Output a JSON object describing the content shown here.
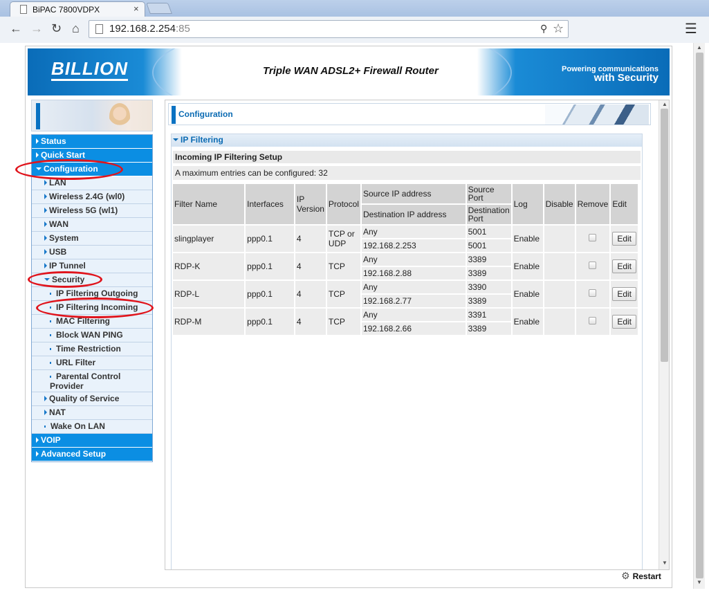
{
  "browser": {
    "tab_title": "BiPAC 7800VDPX",
    "tab_close": "×",
    "url_host": "192.168.2.254",
    "url_port": ":85",
    "icons": [
      "back-icon",
      "forward-icon",
      "reload-icon",
      "home-icon",
      "page-icon",
      "key-icon",
      "star-icon",
      "menu-icon"
    ]
  },
  "banner": {
    "brand": "BILLION",
    "product": "Triple WAN ADSL2+ Firewall Router",
    "tagline_1": "Powering communications",
    "tagline_2": "with Security"
  },
  "nav": {
    "status": "Status",
    "quick_start": "Quick Start",
    "configuration": "Configuration",
    "lan": "LAN",
    "wireless_24": "Wireless 2.4G (wl0)",
    "wireless_5": "Wireless 5G (wl1)",
    "wan": "WAN",
    "system": "System",
    "usb": "USB",
    "ip_tunnel": "IP Tunnel",
    "security": "Security",
    "ip_filter_out": "IP Filtering Outgoing",
    "ip_filter_in": "IP Filtering Incoming",
    "mac_filter": "MAC Filtering",
    "block_wan_ping": "Block WAN PING",
    "time_restriction": "Time Restriction",
    "url_filter": "URL Filter",
    "parental_control": "Parental Control Provider",
    "qos": "Quality of Service",
    "nat": "NAT",
    "wol": "Wake On LAN",
    "voip": "VOIP",
    "advanced_setup": "Advanced Setup"
  },
  "page": {
    "heading": "Configuration",
    "section": "IP Filtering",
    "subtitle": "Incoming IP Filtering Setup",
    "note": "A maximum entries can be configured: 32"
  },
  "table": {
    "headers": {
      "filter_name": "Filter Name",
      "interfaces": "Interfaces",
      "ip_version": "IP Version",
      "protocol": "Protocol",
      "src_ip": "Source IP address",
      "dst_ip": "Destination IP address",
      "src_port": "Source Port",
      "dst_port": "Destination Port",
      "log": "Log",
      "disable": "Disable",
      "remove": "Remove",
      "edit": "Edit"
    },
    "rows": [
      {
        "name": "slingplayer",
        "iface": "ppp0.1",
        "ipver": "4",
        "proto": "TCP or UDP",
        "src_ip": "Any",
        "dst_ip": "192.168.2.253",
        "src_port": "5001",
        "dst_port": "5001",
        "log": "Enable",
        "edit": "Edit"
      },
      {
        "name": "RDP-K",
        "iface": "ppp0.1",
        "ipver": "4",
        "proto": "TCP",
        "src_ip": "Any",
        "dst_ip": "192.168.2.88",
        "src_port": "3389",
        "dst_port": "3389",
        "log": "Enable",
        "edit": "Edit"
      },
      {
        "name": "RDP-L",
        "iface": "ppp0.1",
        "ipver": "4",
        "proto": "TCP",
        "src_ip": "Any",
        "dst_ip": "192.168.2.77",
        "src_port": "3390",
        "dst_port": "3389",
        "log": "Enable",
        "edit": "Edit"
      },
      {
        "name": "RDP-M",
        "iface": "ppp0.1",
        "ipver": "4",
        "proto": "TCP",
        "src_ip": "Any",
        "dst_ip": "192.168.2.66",
        "src_port": "3391",
        "dst_port": "3389",
        "log": "Enable",
        "edit": "Edit"
      }
    ]
  },
  "footer": {
    "restart": "Restart"
  },
  "colors": {
    "nav_top": "#0b8ee3",
    "nav_sub": "#e9f2fb",
    "accent_blue": "#0b6bb3",
    "annotation_red": "#e0141c"
  }
}
